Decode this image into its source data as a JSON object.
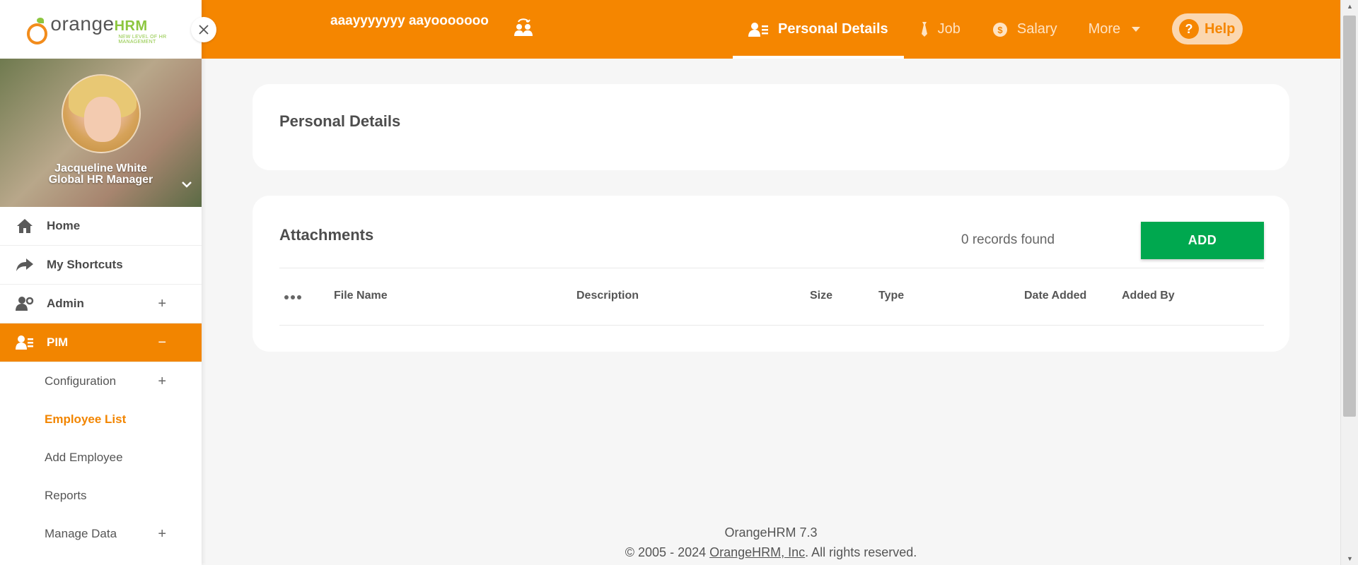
{
  "sidebar": {
    "logo": {
      "text_main": "orange",
      "text_brand": "HRM",
      "tagline": "NEW LEVEL OF HR MANAGEMENT"
    },
    "profile": {
      "name": "Jacqueline White",
      "role": "Global HR Manager"
    },
    "menu": {
      "home": "Home",
      "shortcuts": "My Shortcuts",
      "admin": "Admin",
      "pim": "PIM"
    },
    "pim_submenu": {
      "configuration": "Configuration",
      "employee_list": "Employee List",
      "add_employee": "Add Employee",
      "reports": "Reports",
      "manage_data": "Manage Data"
    },
    "expand_symbol": "+",
    "collapse_symbol": "−"
  },
  "topbar": {
    "employee_name": "aaayyyyyyy aayooooooo",
    "tabs": {
      "personal_details": "Personal Details",
      "job": "Job",
      "salary": "Salary",
      "more": "More"
    },
    "help": "Help"
  },
  "main": {
    "personal_details_title": "Personal Details",
    "attachments": {
      "title": "Attachments",
      "records": "0 records found",
      "add_label": "ADD",
      "columns": {
        "file_name": "File Name",
        "description": "Description",
        "size": "Size",
        "type": "Type",
        "date_added": "Date Added",
        "added_by": "Added By"
      }
    }
  },
  "footer": {
    "version": "OrangeHRM 7.3",
    "copy_prefix": "© 2005 - 2024 ",
    "copy_link": "OrangeHRM, Inc",
    "copy_suffix": ". All rights reserved."
  },
  "colors": {
    "accent": "#f58600",
    "add_button": "#00a84f",
    "sidebar_active": "#f28500"
  }
}
